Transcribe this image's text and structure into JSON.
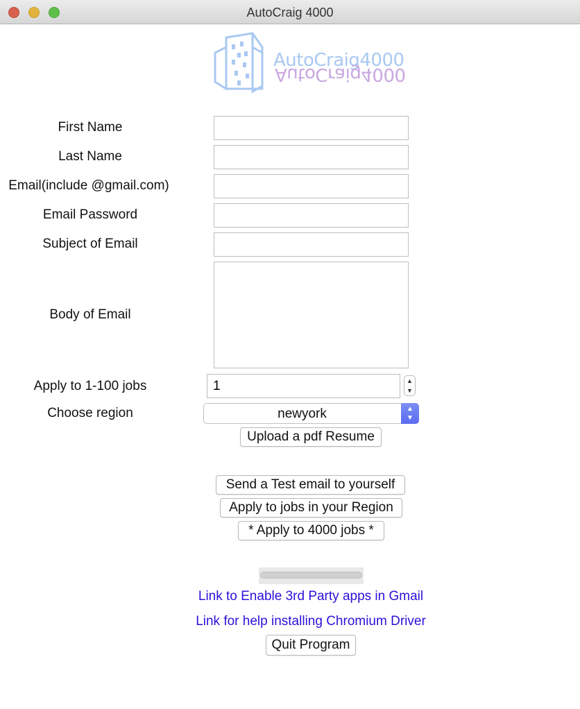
{
  "window": {
    "title": "AutoCraig 4000"
  },
  "logo": {
    "text": "AutoCraig4000"
  },
  "form": {
    "first_name_label": "First Name",
    "last_name_label": "Last Name",
    "email_label": "Email(include @gmail.com)",
    "password_label": "Email Password",
    "subject_label": "Subject of Email",
    "body_label": "Body of Email",
    "first_name_value": "",
    "last_name_value": "",
    "email_value": "",
    "password_value": "",
    "subject_value": "",
    "body_value": "",
    "jobs_label": "Apply to 1-100 jobs",
    "jobs_value": "1",
    "region_label": "Choose region",
    "region_value": "newyork"
  },
  "buttons": {
    "upload": "Upload a pdf Resume",
    "test_email": "Send a Test email to yourself",
    "apply_region": "Apply to jobs in your Region",
    "apply_all": "* Apply to 4000 jobs *",
    "quit": "Quit Program"
  },
  "progress": {
    "value": 0
  },
  "links": {
    "gmail": "Link to Enable 3rd Party apps in Gmail",
    "chromium": "Link for help installing Chromium Driver"
  },
  "colors": {
    "link": "#2a11d9",
    "accent": "#5a6cf0"
  }
}
